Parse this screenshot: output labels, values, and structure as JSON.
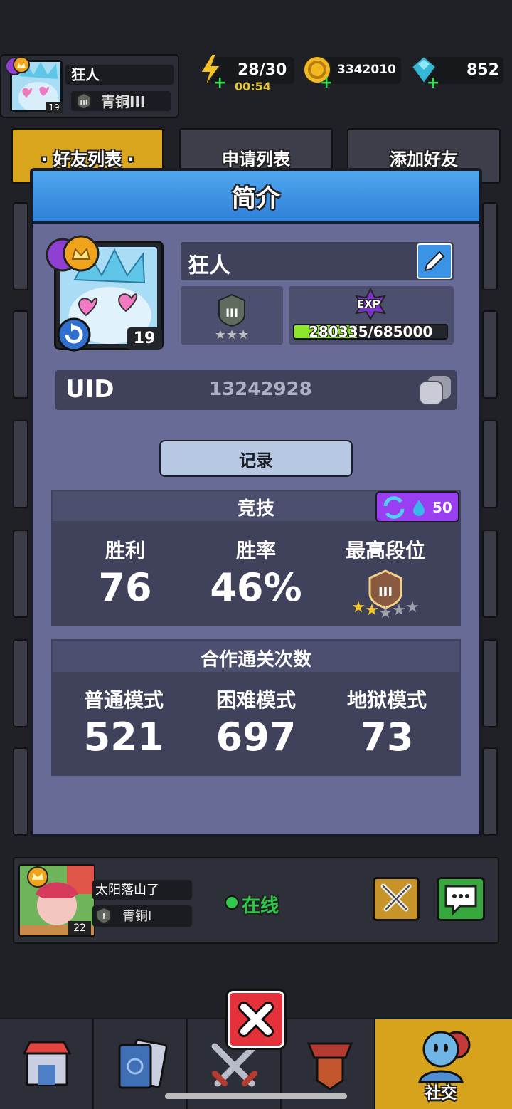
{
  "player": {
    "name": "狂人",
    "level": "19",
    "rank": "青铜III"
  },
  "resources": {
    "energy": "28/30",
    "energy_timer": "00:54",
    "gold": "3342010",
    "gems": "852"
  },
  "tabs": [
    "· 好友列表 ·",
    "申请列表",
    "添加好友"
  ],
  "modal": {
    "title": "简介",
    "exp_label": "EXP",
    "exp_progress": "280335/685000",
    "exp_fraction": 0.41,
    "uid_label": "UID",
    "uid_value": "13242928",
    "record_button": "记录",
    "arena": {
      "title": "竞技",
      "cost": "50",
      "win_label": "胜利",
      "win_value": "76",
      "rate_label": "胜率",
      "rate_value": "46%",
      "best_label": "最高段位"
    },
    "coop": {
      "title": "合作通关次数",
      "normal_label": "普通模式",
      "normal_value": "521",
      "hard_label": "困难模式",
      "hard_value": "697",
      "hell_label": "地狱模式",
      "hell_value": "73"
    }
  },
  "friend": {
    "name": "太阳落山了",
    "rank": "青铜I",
    "level": "22",
    "status": "在线"
  },
  "nav": {
    "social_label": "社交"
  },
  "colors": {
    "modal_header": "#3a8fe3",
    "exp_bar": "#8ce62a",
    "online": "#2ec84a",
    "social_tab": "#d7a21c",
    "close": "#e5323a"
  }
}
